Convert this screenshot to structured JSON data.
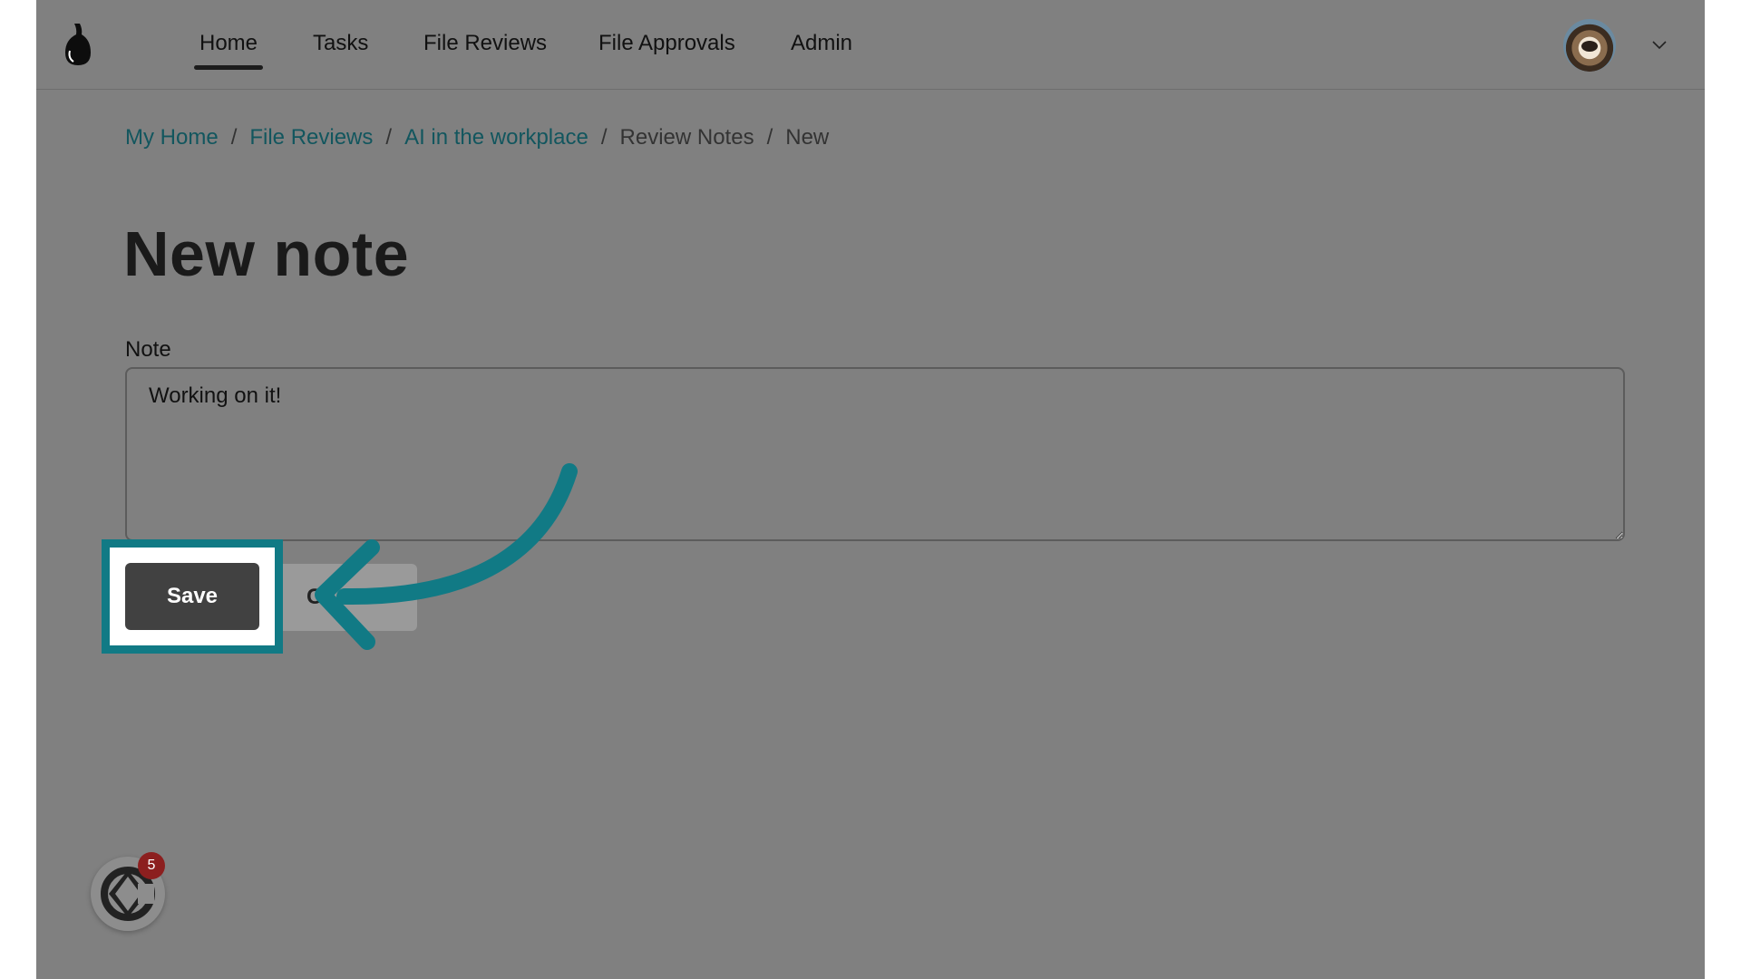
{
  "nav": {
    "items": [
      {
        "label": "Home",
        "active": true
      },
      {
        "label": "Tasks"
      },
      {
        "label": "File Reviews"
      },
      {
        "label": "File Approvals"
      },
      {
        "label": "Admin"
      }
    ],
    "logo_icon": "pear-logo-icon",
    "avatar_icon": "user-avatar",
    "menu_icon": "chevron-down-icon"
  },
  "breadcrumb": {
    "items": [
      "My Home",
      "File Reviews",
      "AI in the workplace",
      "Review Notes"
    ],
    "current": "New",
    "separator": "/"
  },
  "page": {
    "title": "New note",
    "note_label": "Note",
    "note_value": "Working on it!"
  },
  "actions": {
    "save_label": "Save",
    "cancel_label": "C"
  },
  "widget": {
    "icon": "help-widget-icon",
    "badge_count": "5"
  },
  "colors": {
    "overlay": "#808080",
    "link": "#12565e",
    "highlight": "#117a85",
    "save_bg": "#414141",
    "badge": "#8c1f1f"
  }
}
